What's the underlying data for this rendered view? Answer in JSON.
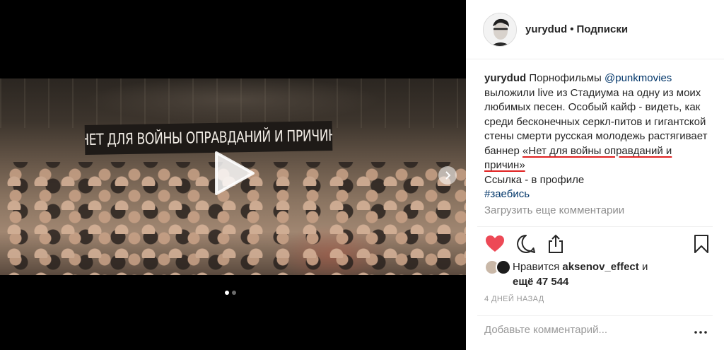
{
  "media": {
    "banner_text": "Нет для войны оправданий и причин",
    "play_icon": "play-icon",
    "next_icon": "chevron-right-icon",
    "carousel_pages": 2,
    "carousel_active": 1
  },
  "header": {
    "username": "yurydud",
    "separator": "•",
    "follow_label": "Подписки"
  },
  "caption": {
    "username": "yurydud",
    "text_1": "Порнофильмы",
    "mention": "@punkmovies",
    "text_2": "выложили live из Стадиума на одну из моих любимых песен. Особый кайф - видеть, как среди бесконечных серкл-питов и гигантской стены смерти русская молодежь растягивает баннер",
    "quote": "«Нет для войны оправданий и причин»",
    "link_note": "Ссылка - в профиле",
    "hashtag": "#заебись"
  },
  "load_more_label": "Загрузить еще комментарии",
  "actions": {
    "like_icon": "heart-icon",
    "comment_icon": "comment-icon",
    "share_icon": "share-icon",
    "save_icon": "bookmark-icon",
    "like_color": "#ed4956"
  },
  "likes": {
    "prefix": "Нравится",
    "user": "aksenov_effect",
    "conjunction": "и",
    "others": "ещё 47 544"
  },
  "timestamp": "4 ДНЕЙ НАЗАД",
  "comment": {
    "placeholder": "Добавьте комментарий...",
    "more_icon": "more-icon"
  }
}
